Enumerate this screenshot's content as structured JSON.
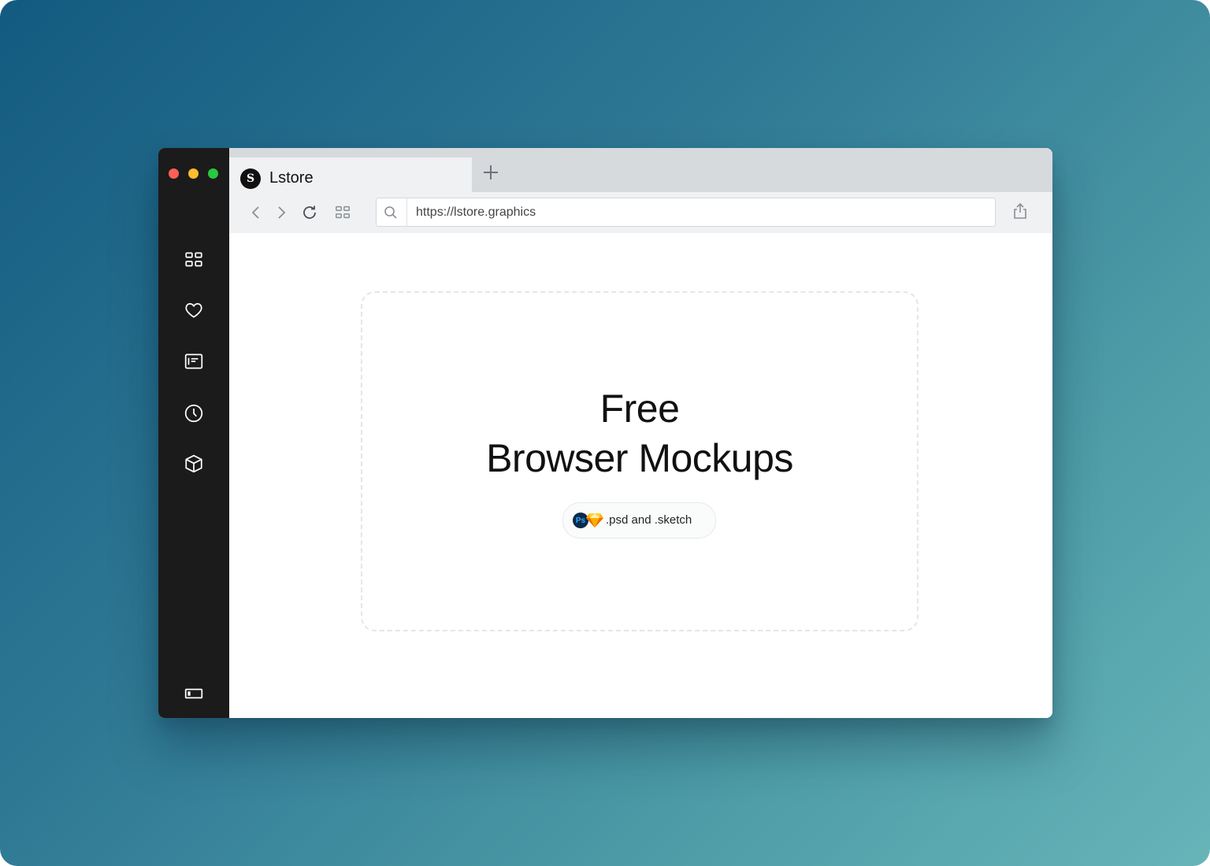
{
  "window": {
    "controls": [
      "close",
      "minimize",
      "maximize"
    ]
  },
  "sidebar": {
    "items": [
      {
        "icon": "grid-icon"
      },
      {
        "icon": "heart-icon"
      },
      {
        "icon": "reader-icon"
      },
      {
        "icon": "clock-icon"
      },
      {
        "icon": "cube-icon"
      }
    ],
    "bottom_icon": "sidebar-toggle-icon"
  },
  "tab": {
    "logo_text": "S",
    "title": "Lstore"
  },
  "toolbar": {
    "url": "https://lstore.graphics"
  },
  "content": {
    "headline_line1": "Free",
    "headline_line2": "Browser Mockups",
    "badge": {
      "ps_label": "Ps",
      "text": ".psd and .sketch"
    }
  },
  "colors": {
    "sidebar_bg": "#1b1b1b",
    "topbar_bg": "#d6dadd",
    "toolbar_bg": "#eff1f3",
    "close": "#fe5f57",
    "minimize": "#febc2e",
    "maximize": "#28c840"
  }
}
